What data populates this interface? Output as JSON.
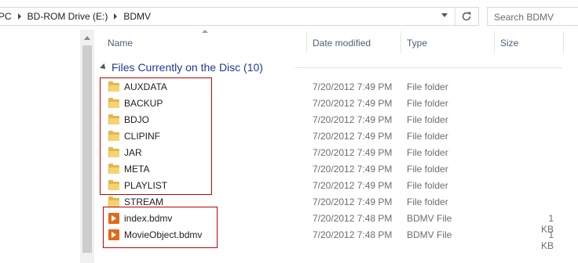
{
  "address": {
    "crumbs": [
      "PC",
      "BD-ROM Drive (E:)",
      "BDMV"
    ]
  },
  "search": {
    "placeholder": "Search BDMV"
  },
  "columns": {
    "name": "Name",
    "date": "Date modified",
    "type": "Type",
    "size": "Size"
  },
  "group": {
    "title": "Files Currently on the Disc (10)"
  },
  "rows": [
    {
      "name": "AUXDATA",
      "date": "7/20/2012 7:49 PM",
      "type": "File folder",
      "size": "",
      "icon": "folder-icon"
    },
    {
      "name": "BACKUP",
      "date": "7/20/2012 7:49 PM",
      "type": "File folder",
      "size": "",
      "icon": "folder-icon"
    },
    {
      "name": "BDJO",
      "date": "7/20/2012 7:49 PM",
      "type": "File folder",
      "size": "",
      "icon": "folder-icon"
    },
    {
      "name": "CLIPINF",
      "date": "7/20/2012 7:49 PM",
      "type": "File folder",
      "size": "",
      "icon": "folder-icon"
    },
    {
      "name": "JAR",
      "date": "7/20/2012 7:49 PM",
      "type": "File folder",
      "size": "",
      "icon": "folder-icon"
    },
    {
      "name": "META",
      "date": "7/20/2012 7:49 PM",
      "type": "File folder",
      "size": "",
      "icon": "folder-icon"
    },
    {
      "name": "PLAYLIST",
      "date": "7/20/2012 7:49 PM",
      "type": "File folder",
      "size": "",
      "icon": "folder-icon"
    },
    {
      "name": "STREAM",
      "date": "7/20/2012 7:49 PM",
      "type": "File folder",
      "size": "",
      "icon": "folder-icon"
    },
    {
      "name": "index.bdmv",
      "date": "7/20/2012 7:48 PM",
      "type": "BDMV File",
      "size": "1 KB",
      "icon": "bdmv-file-icon"
    },
    {
      "name": "MovieObject.bdmv",
      "date": "7/20/2012 7:48 PM",
      "type": "BDMV File",
      "size": "1 KB",
      "icon": "bdmv-file-icon"
    }
  ],
  "colors": {
    "highlight": "#c00000",
    "group_title": "#1f3a93",
    "folder": "#f6d36f",
    "bdmv_icon": "#e06a1c"
  }
}
